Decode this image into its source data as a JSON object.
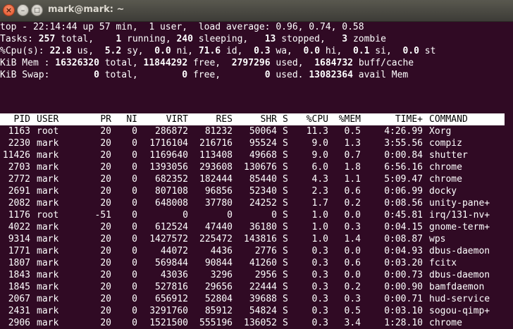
{
  "window": {
    "title": "mark@mark: ~",
    "close": "×",
    "min": "–",
    "max": "□"
  },
  "summary": {
    "line1": "top - 22:14:44 up 57 min,  1 user,  load average: 0.96, 0.74, 0.58",
    "line2": [
      [
        "Tasks: ",
        ""
      ],
      [
        "257",
        "b"
      ],
      [
        " total,    ",
        ""
      ],
      [
        "1",
        "b"
      ],
      [
        " running, ",
        ""
      ],
      [
        "240",
        "b"
      ],
      [
        " sleeping,   ",
        ""
      ],
      [
        "13",
        "b"
      ],
      [
        " stopped,   ",
        ""
      ],
      [
        "3",
        "b"
      ],
      [
        " zombie",
        ""
      ]
    ],
    "line3": [
      [
        "%Cpu(s): ",
        ""
      ],
      [
        "22.8",
        "b"
      ],
      [
        " us,  ",
        ""
      ],
      [
        "5.2",
        "b"
      ],
      [
        " sy,  ",
        ""
      ],
      [
        "0.0",
        "b"
      ],
      [
        " ni, ",
        ""
      ],
      [
        "71.6",
        "b"
      ],
      [
        " id,  ",
        ""
      ],
      [
        "0.3",
        "b"
      ],
      [
        " wa,  ",
        ""
      ],
      [
        "0.0",
        "b"
      ],
      [
        " hi,  ",
        ""
      ],
      [
        "0.1",
        "b"
      ],
      [
        " si,  ",
        ""
      ],
      [
        "0.0",
        "b"
      ],
      [
        " st",
        ""
      ]
    ],
    "line4": [
      [
        "KiB Mem : ",
        ""
      ],
      [
        "16326320",
        "b"
      ],
      [
        " total, ",
        ""
      ],
      [
        "11844292",
        "b"
      ],
      [
        " free,  ",
        ""
      ],
      [
        "2797296",
        "b"
      ],
      [
        " used,  ",
        ""
      ],
      [
        "1684732",
        "b"
      ],
      [
        " buff/cache",
        ""
      ]
    ],
    "line5": [
      [
        "KiB Swap:        ",
        ""
      ],
      [
        "0",
        "b"
      ],
      [
        " total,        ",
        ""
      ],
      [
        "0",
        "b"
      ],
      [
        " free,        ",
        ""
      ],
      [
        "0",
        "b"
      ],
      [
        " used. ",
        ""
      ],
      [
        "13082364",
        "b"
      ],
      [
        " avail Mem",
        ""
      ]
    ]
  },
  "columns": [
    "PID",
    "USER",
    "PR",
    "NI",
    "VIRT",
    "RES",
    "SHR",
    "S",
    "%CPU",
    "%MEM",
    "TIME+",
    "COMMAND"
  ],
  "processes": [
    [
      "1163",
      "root",
      "20",
      "0",
      "286872",
      "81232",
      "50064",
      "S",
      "11.3",
      "0.5",
      "4:26.99",
      "Xorg"
    ],
    [
      "2230",
      "mark",
      "20",
      "0",
      "1716104",
      "216716",
      "95524",
      "S",
      "9.0",
      "1.3",
      "3:55.56",
      "compiz"
    ],
    [
      "11426",
      "mark",
      "20",
      "0",
      "1169640",
      "113408",
      "49668",
      "S",
      "9.0",
      "0.7",
      "0:00.84",
      "shutter"
    ],
    [
      "2703",
      "mark",
      "20",
      "0",
      "1393056",
      "293608",
      "130676",
      "S",
      "6.0",
      "1.8",
      "6:56.16",
      "chrome"
    ],
    [
      "2772",
      "mark",
      "20",
      "0",
      "682352",
      "182444",
      "85440",
      "S",
      "4.3",
      "1.1",
      "5:09.47",
      "chrome"
    ],
    [
      "2691",
      "mark",
      "20",
      "0",
      "807108",
      "96856",
      "52340",
      "S",
      "2.3",
      "0.6",
      "0:06.99",
      "docky"
    ],
    [
      "2082",
      "mark",
      "20",
      "0",
      "648008",
      "37780",
      "24252",
      "S",
      "1.7",
      "0.2",
      "0:08.56",
      "unity-pane+"
    ],
    [
      "1176",
      "root",
      "-51",
      "0",
      "0",
      "0",
      "0",
      "S",
      "1.0",
      "0.0",
      "0:45.81",
      "irq/131-nv+"
    ],
    [
      "4022",
      "mark",
      "20",
      "0",
      "612524",
      "47440",
      "36180",
      "S",
      "1.0",
      "0.3",
      "0:04.15",
      "gnome-term+"
    ],
    [
      "9314",
      "mark",
      "20",
      "0",
      "1427572",
      "225472",
      "143816",
      "S",
      "1.0",
      "1.4",
      "0:08.87",
      "wps"
    ],
    [
      "1771",
      "mark",
      "20",
      "0",
      "44072",
      "4436",
      "2776",
      "S",
      "0.3",
      "0.0",
      "0:04.93",
      "dbus-daemon"
    ],
    [
      "1807",
      "mark",
      "20",
      "0",
      "569844",
      "90844",
      "41260",
      "S",
      "0.3",
      "0.6",
      "0:03.20",
      "fcitx"
    ],
    [
      "1843",
      "mark",
      "20",
      "0",
      "43036",
      "3296",
      "2956",
      "S",
      "0.3",
      "0.0",
      "0:00.73",
      "dbus-daemon"
    ],
    [
      "1845",
      "mark",
      "20",
      "0",
      "527816",
      "29656",
      "22444",
      "S",
      "0.3",
      "0.2",
      "0:00.90",
      "bamfdaemon"
    ],
    [
      "2067",
      "mark",
      "20",
      "0",
      "656912",
      "52804",
      "39688",
      "S",
      "0.3",
      "0.3",
      "0:00.71",
      "hud-service"
    ],
    [
      "2431",
      "mark",
      "20",
      "0",
      "3291760",
      "85912",
      "54824",
      "S",
      "0.3",
      "0.5",
      "0:03.10",
      "sogou-qimp+"
    ],
    [
      "2906",
      "mark",
      "20",
      "0",
      "1521500",
      "555196",
      "136052",
      "S",
      "0.3",
      "3.4",
      "1:28.10",
      "chrome"
    ]
  ]
}
